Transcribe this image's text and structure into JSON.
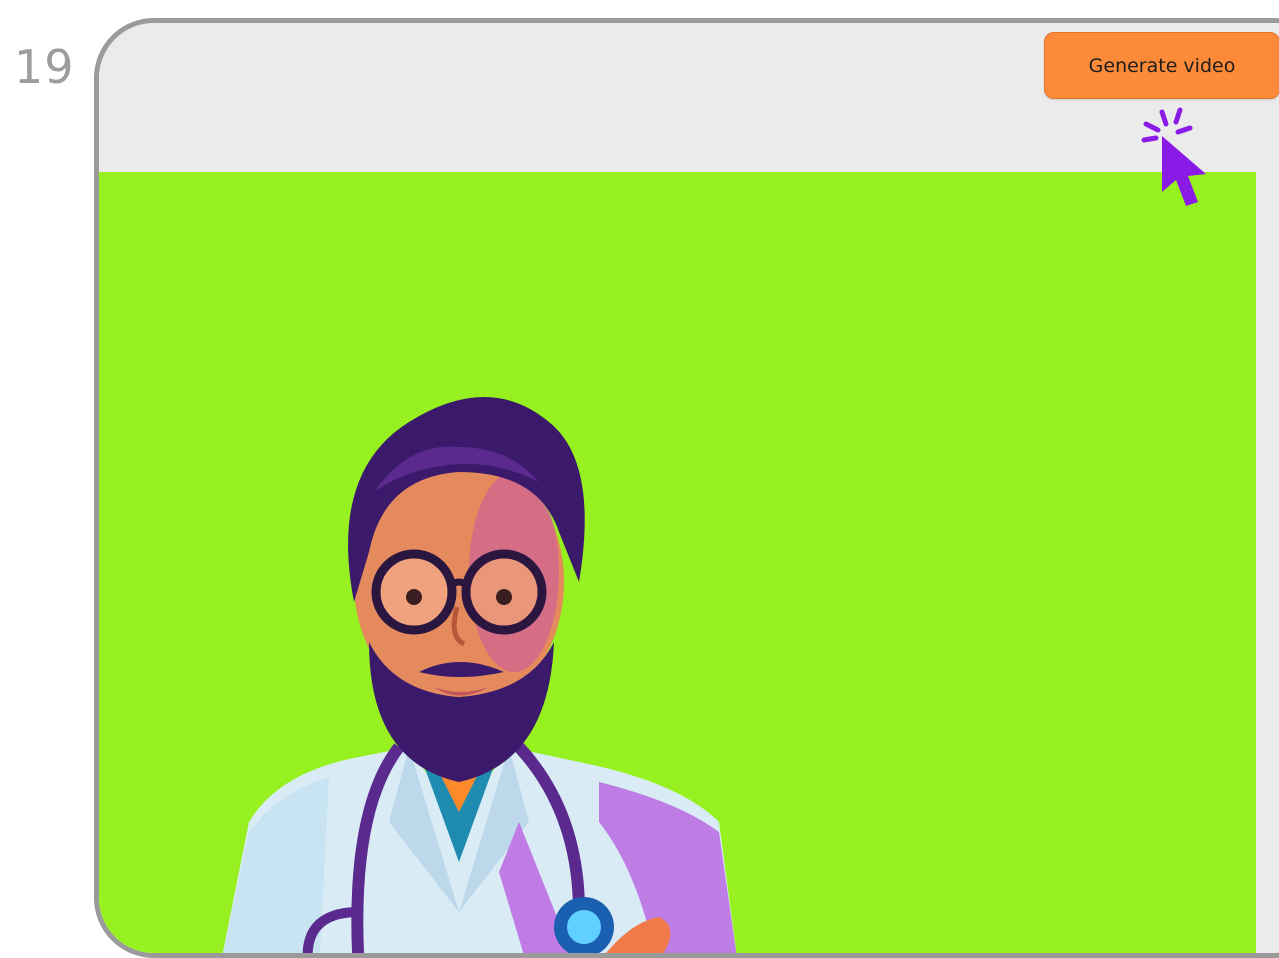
{
  "step": {
    "number": "19"
  },
  "toolbar": {
    "generate_label": "Generate video"
  },
  "icons": {
    "cursor": "click-cursor-icon",
    "avatar": "doctor-avatar-illustration"
  },
  "colors": {
    "canvas_background": "#97f121",
    "button": "#fd8a38",
    "cursor": "#8a1be6",
    "frame_border": "#9a9a9a",
    "toolbar_background": "#ebebeb"
  }
}
